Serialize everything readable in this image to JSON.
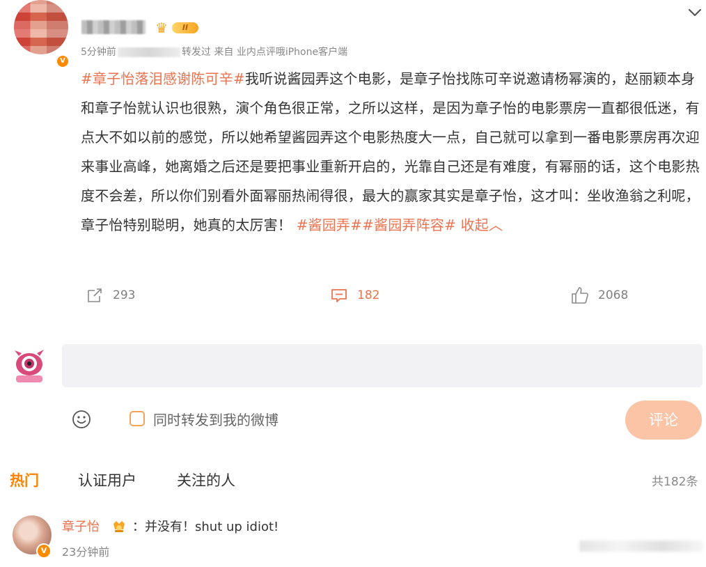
{
  "post": {
    "meta_time": "5分钟前",
    "meta_repost": "转发过",
    "meta_source": "来自 业内点评哦iPhone客户端",
    "level_badge": "II",
    "body_parts": {
      "topic_1": "#章子怡落泪感谢陈可辛#",
      "text_1": "我听说酱园弄这个电影，是章子怡找陈可辛说邀请杨幂演的，赵丽颖本身和章子怡就认识也很熟，演个角色很正常，之所以这样，是因为章子怡的电影票房一直都很低迷，有点大不如以前的感觉，所以她希望酱园弄这个电影热度大一点，自己就可以拿到一番电影票房再次迎来事业高峰，她离婚之后还是要把事业重新开启的，光靠自己还是有难度，有幂丽的话，这个电影热度不会差，所以你们别看外面幂丽热闹得很，最大的赢家其实是章子怡，这才叫：坐收渔翁之利呢，章子怡特别聪明，她真的太厉害！",
      "topic_2": "#酱园弄#",
      "topic_3": "#酱园弄阵容#",
      "collapse": "收起"
    },
    "actions": {
      "repost_count": "293",
      "comment_count": "182",
      "like_count": "2068"
    }
  },
  "composer": {
    "repost_label": "同时转发到我的微博",
    "submit_label": "评论"
  },
  "comments_tabs": {
    "hot": "热门",
    "verified": "认证用户",
    "following": "关注的人",
    "total": "共182条"
  },
  "comment": {
    "author": "章子怡",
    "text": "：并没有！shut up idiot!",
    "time": "23分钟前"
  },
  "colors": {
    "accent_orange": "#eb7350",
    "tab_orange": "#ff8200",
    "submit_disabled": "#fbc4a6"
  }
}
